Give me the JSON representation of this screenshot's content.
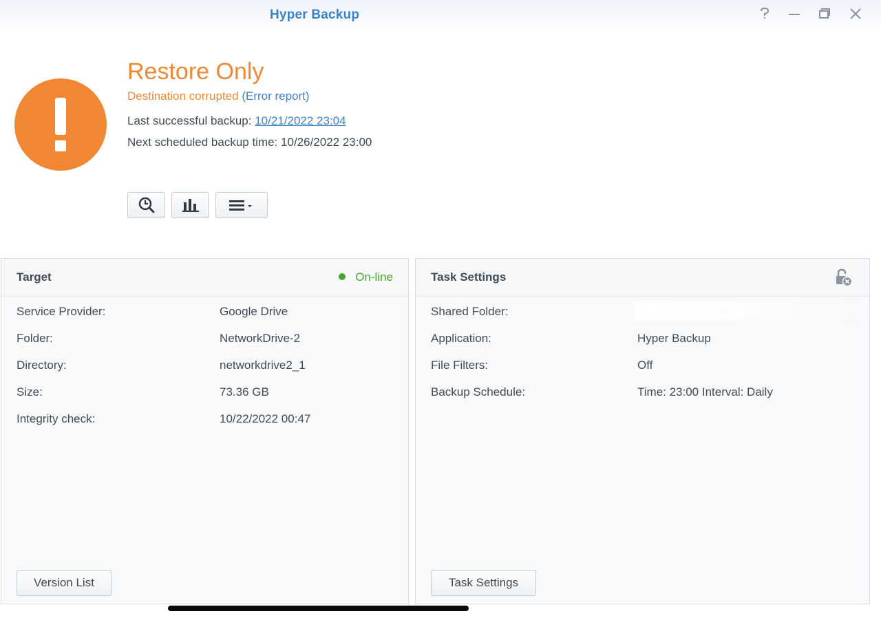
{
  "app": {
    "title": "Hyper Backup"
  },
  "window_controls": {
    "help": "?",
    "minimize": "—",
    "restore": "▭",
    "close": "✕"
  },
  "status": {
    "title": "Restore Only",
    "subtitle": "Destination corrupted",
    "error_link": "(Error report)",
    "last_backup_label": "Last successful backup:",
    "last_backup_value": "10/21/2022 23:04",
    "next_backup_label": "Next scheduled backup time:",
    "next_backup_value": "10/26/2022 23:00"
  },
  "toolbar": {
    "icons": [
      "clock-search-icon",
      "bar-chart-icon",
      "menu-dropdown-icon"
    ]
  },
  "target_panel": {
    "title": "Target",
    "status": "On-line",
    "rows": [
      {
        "label": "Service Provider:",
        "value": "Google Drive"
      },
      {
        "label": "Folder:",
        "value": "NetworkDrive-2"
      },
      {
        "label": "Directory:",
        "value": "networkdrive2_1"
      },
      {
        "label": "Size:",
        "value": "73.36 GB"
      },
      {
        "label": "Integrity check:",
        "value": "10/22/2022 00:47"
      }
    ],
    "button": "Version List"
  },
  "task_panel": {
    "title": "Task Settings",
    "rows": [
      {
        "label": "Shared Folder:",
        "value": ""
      },
      {
        "label": "Application:",
        "value": "Hyper Backup"
      },
      {
        "label": "File Filters:",
        "value": "Off"
      },
      {
        "label": "Backup Schedule:",
        "value": "Time: 23:00 Interval: Daily"
      }
    ],
    "button": "Task Settings"
  },
  "colors": {
    "accent": "#3b82c7",
    "warning": "#ef8733",
    "online": "#4aa52e"
  }
}
